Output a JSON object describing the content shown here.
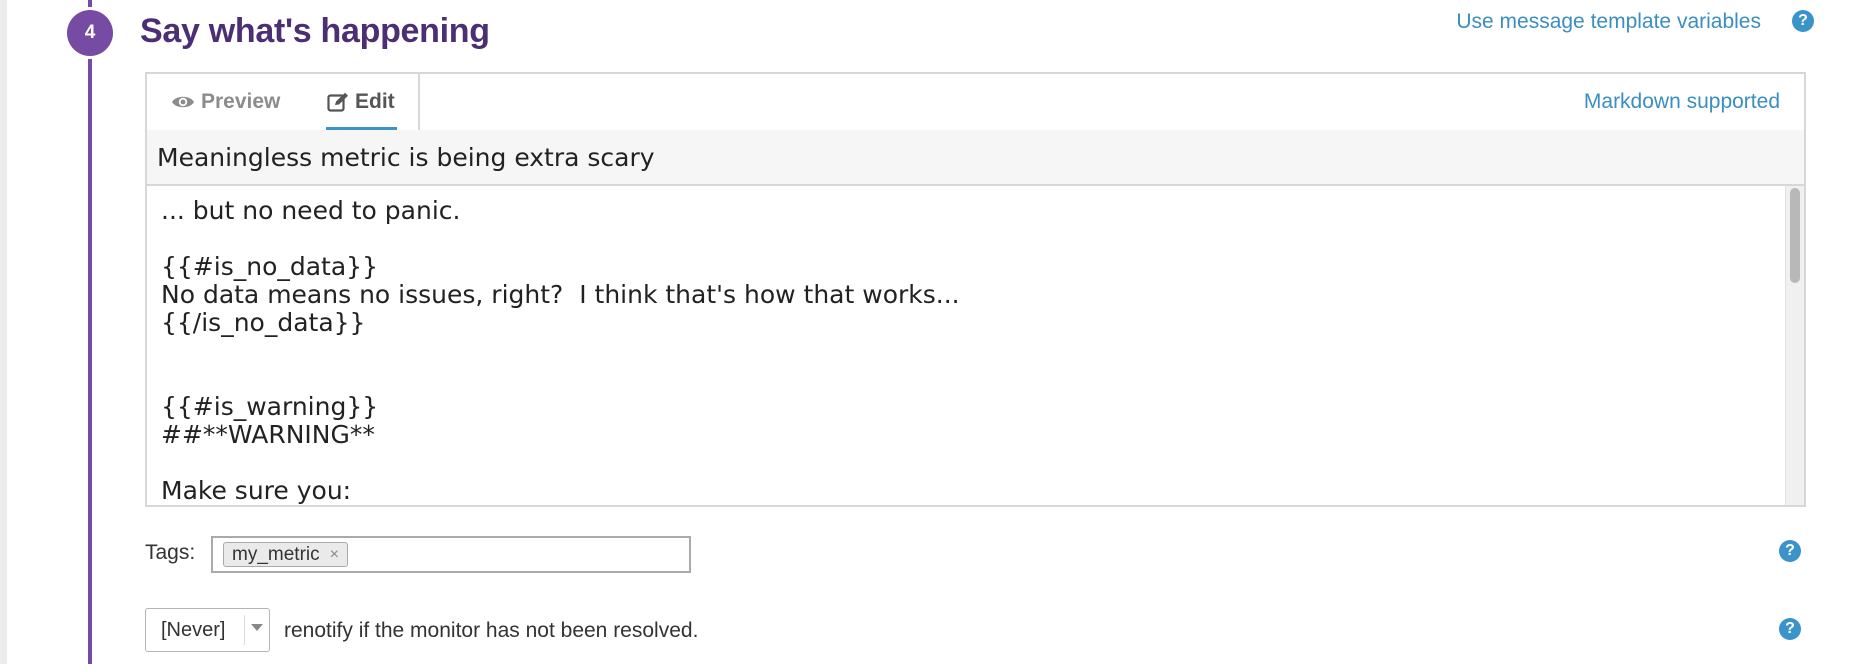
{
  "step": {
    "number": "4",
    "title": "Say what's happening",
    "template_link": "Use message template variables"
  },
  "editor": {
    "tabs": [
      {
        "label": "Preview",
        "icon": "eye-icon",
        "active": false
      },
      {
        "label": "Edit",
        "icon": "edit-icon",
        "active": true
      }
    ],
    "markdown_label": "Markdown supported",
    "title_value": "Meaningless metric is being extra scary",
    "body_lines": [
      "... but no need to panic.",
      "",
      "{{#is_no_data}}",
      "No data means no issues, right?  I think that's how that works...",
      "{{/is_no_data}}",
      "",
      "",
      "{{#is_warning}}",
      "##**WARNING**",
      "",
      "Make sure you:"
    ]
  },
  "tags": {
    "label": "Tags:",
    "items": [
      {
        "text": "my_metric",
        "remove": "×"
      }
    ]
  },
  "renotify": {
    "selected": "[Never]",
    "text": "renotify if the monitor has not been resolved."
  },
  "help_glyph": "?",
  "colors": {
    "accent_purple": "#774aa4",
    "title_purple": "#4c2e74",
    "link_blue": "#3b8ec0",
    "help_blue": "#3a93c9"
  }
}
